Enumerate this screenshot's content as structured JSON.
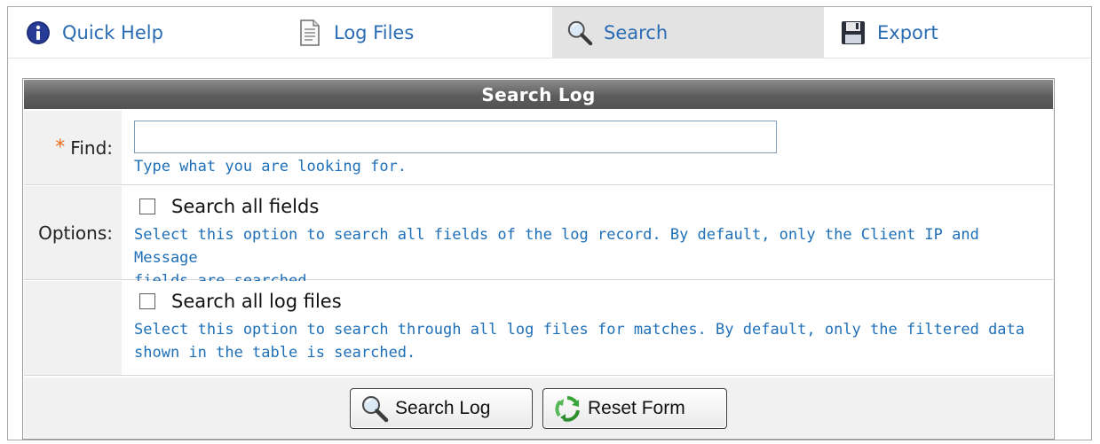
{
  "tabs": [
    {
      "label": "Quick Help",
      "icon": "info-icon"
    },
    {
      "label": "Log Files",
      "icon": "document-icon"
    },
    {
      "label": "Search",
      "icon": "magnifier-icon",
      "active": true
    },
    {
      "label": "Export",
      "icon": "floppy-disk-icon"
    }
  ],
  "form": {
    "title": "Search Log",
    "find": {
      "required_mark": "*",
      "label": "Find:",
      "value": "",
      "hint": "Type what you are looking for."
    },
    "options": {
      "label": "Options:",
      "search_all_fields": {
        "label": "Search all fields",
        "checked": false,
        "hint_line1": "Select this option to search all fields of the log record. By default, only the Client IP and Message",
        "hint_line2": "fields are searched."
      },
      "search_all_log_files": {
        "label": "Search all log files",
        "checked": false,
        "hint_line1": "Select this option to search through all log files for matches. By default, only the filtered data",
        "hint_line2": "shown in the table is searched."
      }
    },
    "buttons": {
      "search_label": "Search Log",
      "reset_label": "Reset Form"
    }
  },
  "colors": {
    "link_blue": "#2a6cb4",
    "hint_blue": "#1e6fb8",
    "required_orange": "#ef6b1a",
    "header_gray": "#5d5d5d"
  }
}
